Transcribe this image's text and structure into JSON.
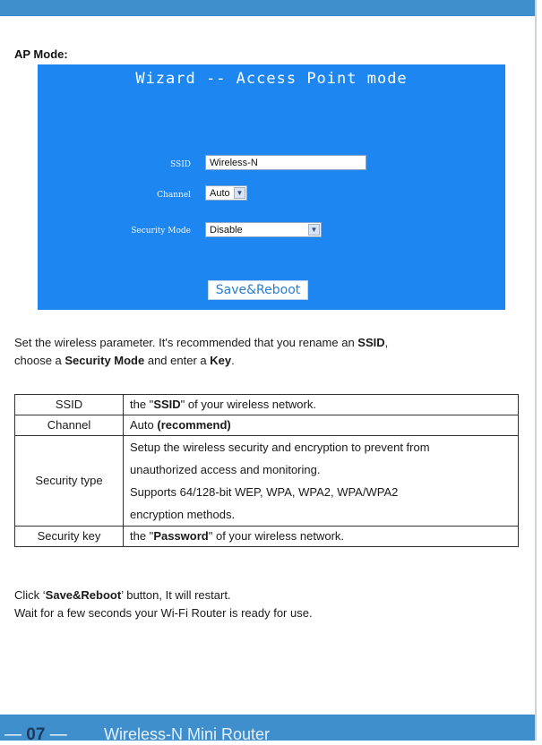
{
  "header": {},
  "section": {
    "title": "AP Mode:"
  },
  "wizard": {
    "title": "Wizard -- Access Point mode",
    "ssid_label": "SSID",
    "ssid_value": "Wireless-N",
    "channel_label": "Channel",
    "channel_value": "Auto",
    "security_label": "Security Mode",
    "security_value": "Disable",
    "save_button": "Save&Reboot"
  },
  "intro": {
    "part1": "Set the wireless parameter. It's recommended that you rename an ",
    "ssid": "SSID",
    "part2": ",",
    "part3": "choose a ",
    "security_mode": "Security Mode",
    "part4": " and enter a ",
    "key": "Key",
    "part5": "."
  },
  "table": {
    "rows": [
      {
        "key": "SSID",
        "pre": "the \"",
        "bold": "SSID",
        "post": "\" of your wireless network."
      },
      {
        "key": "Channel",
        "pre": "Auto ",
        "bold": "(recommend)",
        "post": ""
      },
      {
        "key": "Security type",
        "lines": [
          "Setup the wireless security and encryption to prevent from",
          "unauthorized access and monitoring.",
          "Supports 64/128-bit WEP, WPA, WPA2, WPA/WPA2",
          "encryption methods."
        ]
      },
      {
        "key": "Security key",
        "pre": "the \"",
        "bold": "Password",
        "post": "\" of your wireless network."
      }
    ]
  },
  "outro": {
    "click_pre": "Click ‘",
    "click_bold": "Save&Reboot",
    "click_post": "’ button, It will restart.",
    "wait": "Wait for a few seconds your Wi-Fi Router is ready for use."
  },
  "footer": {
    "dash_left": "—",
    "page_number": "07",
    "dash_right": "—",
    "product": "Wireless-N Mini Router"
  },
  "colors": {
    "brand_blue": "#3f8fcd",
    "wizard_blue": "#1e86f0"
  }
}
